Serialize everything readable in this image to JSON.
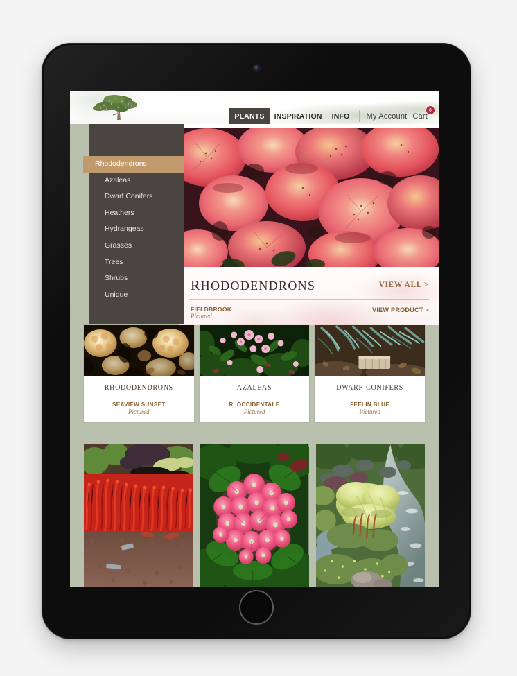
{
  "device": {
    "camera_icon": "front-camera-icon",
    "home_button_icon": "home-button-icon"
  },
  "site": {
    "logo_icon": "bonsai-tree-logo-icon",
    "background_color": "#b9c0ae",
    "accent_color": "#c09a6d",
    "panel_color": "#4b4542",
    "heading_color": "#3a2a23"
  },
  "nav": {
    "tabs": [
      {
        "label": "PLANTS",
        "active": true
      },
      {
        "label": "INSPIRATION",
        "active": false
      },
      {
        "label": "INFO",
        "active": false
      }
    ],
    "account_label": "My Account",
    "cart_label": "Cart",
    "cart_count": "0",
    "cart_badge_color": "#b12a3e"
  },
  "sidebar": {
    "items": [
      {
        "label": "Rhododendrons",
        "active": true
      },
      {
        "label": "Azaleas",
        "active": false
      },
      {
        "label": "Dwarf Conifers",
        "active": false
      },
      {
        "label": "Heathers",
        "active": false
      },
      {
        "label": "Hydrangeas",
        "active": false
      },
      {
        "label": "Grasses",
        "active": false
      },
      {
        "label": "Trees",
        "active": false
      },
      {
        "label": "Shrubs",
        "active": false
      },
      {
        "label": "Unique",
        "active": false
      }
    ]
  },
  "hero": {
    "title": "Rhododendrons",
    "view_all_label": "VIEW ALL >",
    "plant_name": "FIELDBROOK",
    "pictured_label": "Pictured",
    "view_product_label": "VIEW PRODUCT >",
    "photo_alt": "coral pink rhododendron blossoms"
  },
  "cards": [
    {
      "title": "Rhododendrons",
      "plant_name": "SEAVIEW SUNSET",
      "pictured_label": "Pictured",
      "photo_alt": "pale yellow rhododendron truss"
    },
    {
      "title": "Azaleas",
      "plant_name": "R. OCCIDENTALE",
      "pictured_label": "Pictured",
      "photo_alt": "pink western azalea in foliage"
    },
    {
      "title": "Dwarf Conifers",
      "plant_name": "FEELIN BLUE",
      "pictured_label": "Pictured",
      "photo_alt": "blue green dwarf conifer with stone"
    }
  ],
  "gallery": [
    {
      "photo_alt": "red heather bed with gravel path"
    },
    {
      "photo_alt": "pink hydrangea bloom close up"
    },
    {
      "photo_alt": "golden conifer beside garden stream"
    }
  ]
}
